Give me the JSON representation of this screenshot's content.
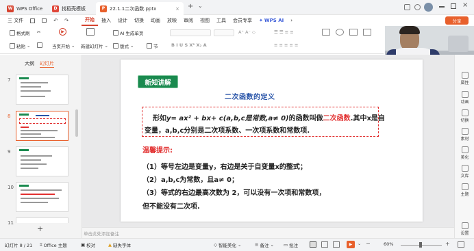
{
  "tabs": [
    {
      "label": "WPS Office"
    },
    {
      "label": "找稻壳模板"
    },
    {
      "label": "22.1.1二次函数.pptx"
    }
  ],
  "titlebar": {
    "add_tab": "+",
    "dropdown": "⌄"
  },
  "menu": {
    "file": "三 文件",
    "items": [
      "开始",
      "插入",
      "设计",
      "切换",
      "动画",
      "放映",
      "审阅",
      "视图",
      "工具",
      "会员专享"
    ],
    "wps_ai": "WPS AI",
    "share": "分享"
  },
  "toolbar": {
    "format_brush": "格式刷",
    "paste": "粘贴",
    "play_from_current": "当页开始",
    "new_slide": "新建幻灯片",
    "ai_generate": "AI 生成单页",
    "layout": "版式",
    "section": "节"
  },
  "panel": {
    "tab_outline": "大纲",
    "tab_slides": "幻灯片",
    "slide_numbers": [
      "7",
      "8",
      "9",
      "10",
      "11"
    ],
    "add_slide": "+"
  },
  "slide": {
    "section_tag": "新知讲解",
    "title": "二次函数的定义",
    "def_line1_a": "形如",
    "def_formula": "y= ax² + bx+ c(a,b,c是常数,a≠ 0)",
    "def_line1_b": "的函数叫做",
    "def_term": "二次函数",
    "def_line1_c": ".其中x是自",
    "def_line2": "变量，a,b,c分别是二次项系数、一次项系数和常数项.",
    "tip_label": "温馨提示:",
    "tips": [
      "（1）等号左边是变量y，右边是关于自变量x的整式；",
      "（2）a,b,c为常数，且a≠ 0；",
      "（3）等式的右边最高次数为 2，可以没有一次项和常数项，",
      "但不能没有二次项."
    ]
  },
  "notes_placeholder": "单击此处添加备注",
  "right_rail": [
    "属性",
    "动画",
    "切换",
    "素材",
    "美化",
    "文库",
    "主题",
    "设置"
  ],
  "status": {
    "slide_count": "幻灯片 8 / 21",
    "theme": "Office 主题",
    "proofread": "校对",
    "missing_font": "缺失字体",
    "smart_beautify": "智能美化",
    "notes": "备注",
    "comments": "批注",
    "zoom": "60%"
  },
  "colors": {
    "accent": "#d6432f",
    "tag_green": "#1a8a4f",
    "title_blue": "#2753a8",
    "dashed_red": "#e23030"
  }
}
